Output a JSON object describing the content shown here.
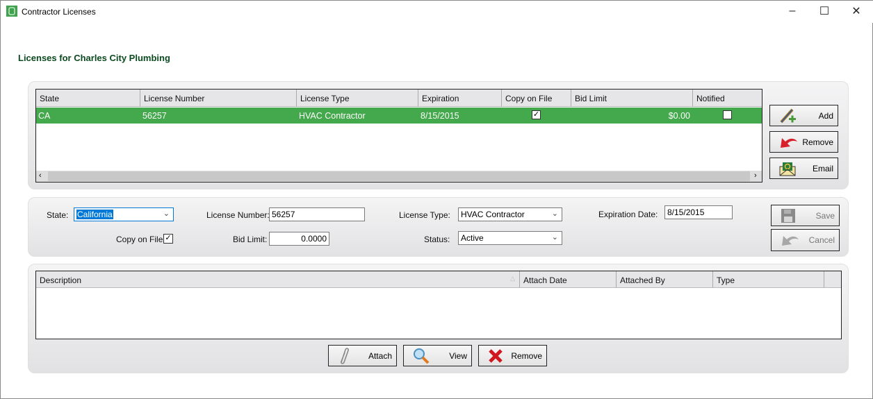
{
  "window": {
    "title": "Contractor Licenses",
    "controls": [
      "minimize",
      "maximize",
      "close"
    ]
  },
  "heading": "Licenses for Charles City Plumbing",
  "licenses_grid": {
    "columns": [
      "State",
      "License Number",
      "License Type",
      "Expiration",
      "Copy on File",
      "Bid Limit",
      "Notified"
    ],
    "rows": [
      {
        "state": "CA",
        "license_number": "56257",
        "license_type": "HVAC Contractor",
        "expiration": "8/15/2015",
        "copy_on_file": true,
        "bid_limit": "$0.00",
        "notified": false
      }
    ],
    "selected_row_color": "#44a84c"
  },
  "grid_buttons": {
    "add": "Add",
    "remove": "Remove",
    "email": "Email"
  },
  "form": {
    "state_label": "State:",
    "state_value": "California",
    "license_number_label": "License Number:",
    "license_number_value": "56257",
    "license_type_label": "License Type:",
    "license_type_value": "HVAC Contractor",
    "expiration_label": "Expiration Date:",
    "expiration_value": "8/15/2015",
    "copy_on_file_label": "Copy on File",
    "copy_on_file_checked": true,
    "bid_limit_label": "Bid Limit:",
    "bid_limit_value": "0.0000",
    "status_label": "Status:",
    "status_value": "Active",
    "save": "Save",
    "cancel": "Cancel"
  },
  "documents_grid": {
    "columns": [
      "Description",
      "Attach Date",
      "Attached By",
      "Type"
    ],
    "rows": []
  },
  "doc_buttons": {
    "attach": "Attach",
    "view": "View",
    "remove": "Remove"
  }
}
